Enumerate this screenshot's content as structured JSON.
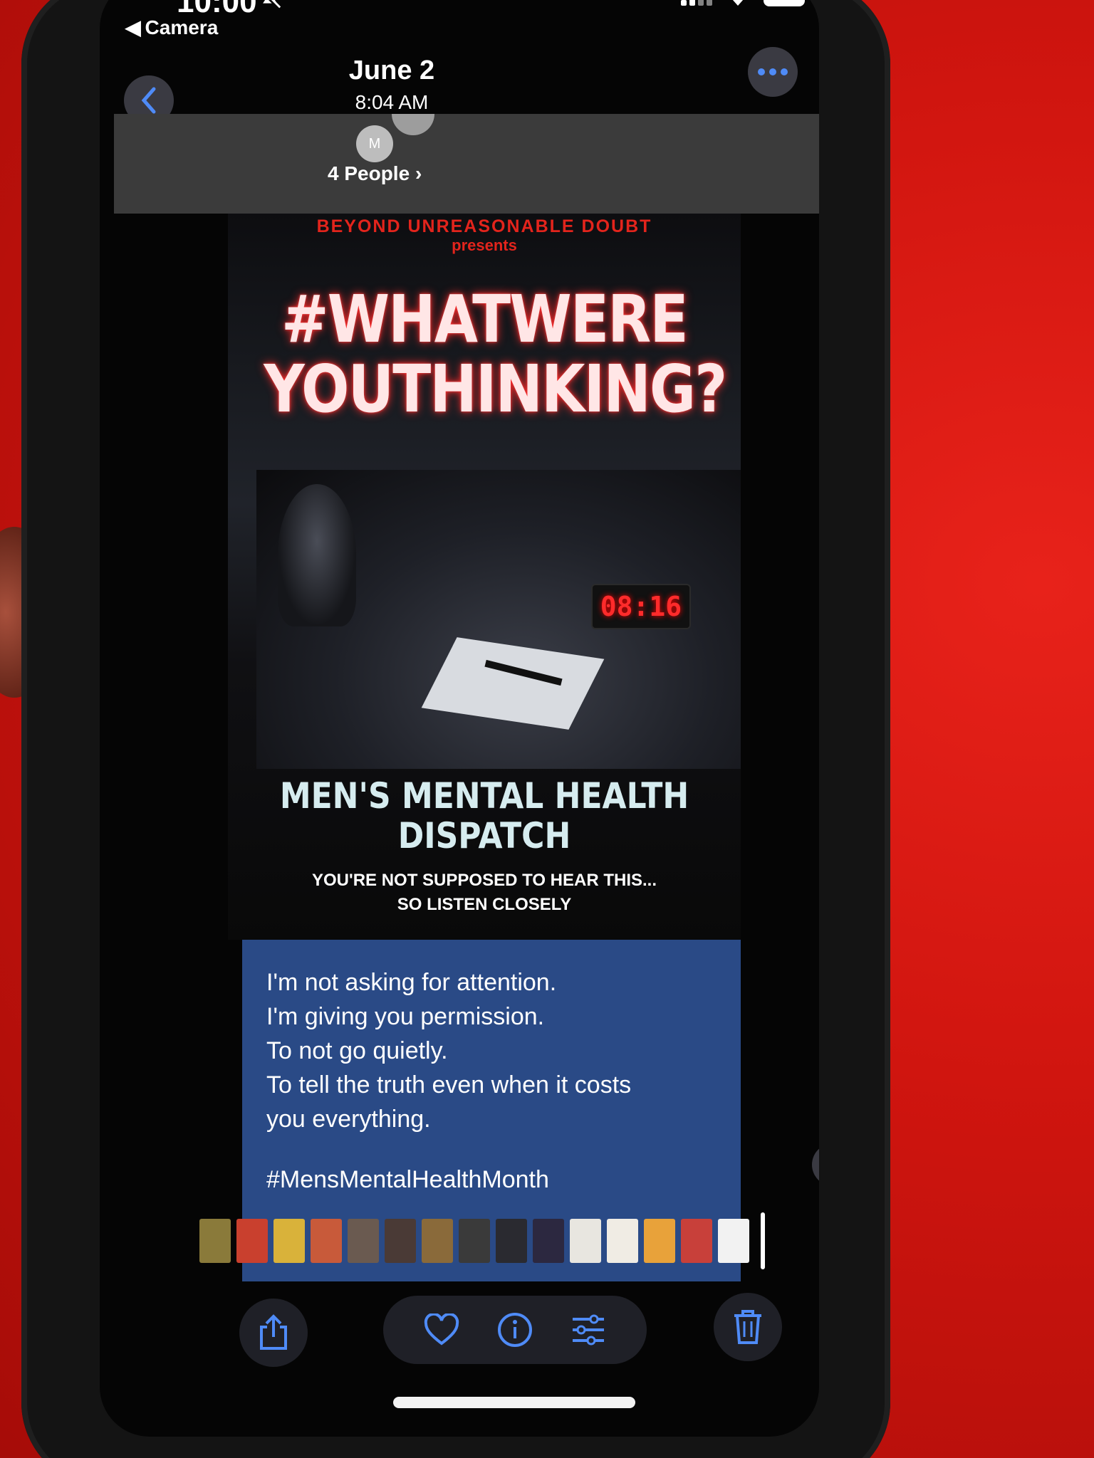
{
  "status_bar": {
    "time": "10:00",
    "back_app": "Camera"
  },
  "nav": {
    "date": "June 2",
    "time": "8:04 AM",
    "avatar_initial": "M",
    "people": "4 People"
  },
  "poster": {
    "presenter": "BEYOND UNREASONABLE DOUBT",
    "presents": "presents",
    "headline": "#WHATWERE\nYOUTHINKING?",
    "clock": "08:16",
    "subtitle": "MEN'S MENTAL HEALTH\nDISPATCH",
    "tagline": "YOU'RE NOT SUPPOSED TO HEAR THIS...\nSO LISTEN CLOSELY"
  },
  "caption": {
    "body": "I'm not asking for attention.\nI'm giving you permission.\nTo not go quietly.\nTo tell the truth even when it costs\nyou everything.",
    "hashtag": "#MensMentalHealthMonth"
  },
  "colors": {
    "accent": "#3b82f6",
    "poster_red": "#e3241c",
    "caption_bg": "#2a4a86"
  },
  "icons": [
    "bell-off-icon",
    "chevron-left-icon",
    "ellipsis-icon",
    "live-text-icon",
    "share-icon",
    "heart-icon",
    "info-icon",
    "adjust-icon",
    "trash-icon"
  ]
}
